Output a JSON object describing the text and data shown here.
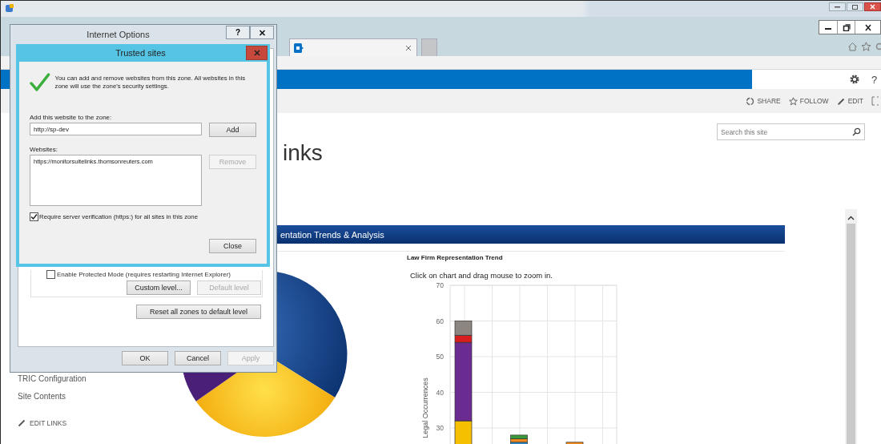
{
  "browser": {
    "tabs": [
      {
        "kind": "page",
        "selected": true
      },
      {
        "kind": "new",
        "selected": false
      }
    ]
  },
  "site": {
    "help": "?",
    "actions": [
      {
        "kind": "share",
        "label": "SHARE"
      },
      {
        "kind": "follow",
        "label": "FOLLOW"
      },
      {
        "kind": "edit",
        "label": "EDIT"
      }
    ],
    "search": {
      "placeholder": "Search this site"
    },
    "page_title": "inks",
    "nav": [
      {
        "label": "TRIC Configuration"
      },
      {
        "label": "Site Contents"
      }
    ],
    "edit_links": "EDIT LINKS",
    "web_part": {
      "title": "entation Trends & Analysis",
      "chart_title": "Law Firm Representation Trend",
      "hint": "Click on chart and drag mouse to zoom in.",
      "chart_data": {
        "type": "bar",
        "stacked": true,
        "grid": true,
        "ylabel": "Legal Occurrences",
        "ylim": [
          0,
          70
        ],
        "yticks": [
          30,
          40,
          50,
          60,
          70
        ],
        "series": [
          {
            "color": "#f5c000",
            "values": [
              32,
              null,
              null
            ]
          },
          {
            "color": "#6a2c91",
            "values": [
              22,
              null,
              null
            ]
          },
          {
            "color": "#d81e1e",
            "values": [
              2,
              null,
              null
            ]
          },
          {
            "color": "#8c8580",
            "values": [
              4,
              null,
              null
            ]
          },
          {
            "color": "#2e8bd0",
            "values": [
              null,
              26,
              null
            ]
          },
          {
            "color": "#f08a1c",
            "values": [
              null,
              1,
              26
            ]
          },
          {
            "color": "#3a9a3a",
            "values": [
              null,
              1,
              null
            ]
          }
        ]
      }
    }
  },
  "internet_options": {
    "title": "Internet Options",
    "help": "?",
    "protected_mode": {
      "label": "Enable Protected Mode (requires restarting Internet Explorer)",
      "checked": false
    },
    "zone_buttons": [
      {
        "label": "Custom level...",
        "disabled": false
      },
      {
        "label": "Default level",
        "disabled": true
      }
    ],
    "reset_button": "Reset all zones to default level",
    "buttons": [
      {
        "label": "OK",
        "disabled": false
      },
      {
        "label": "Cancel",
        "disabled": false
      },
      {
        "label": "Apply",
        "disabled": true
      }
    ]
  },
  "trusted_sites": {
    "title": "Trusted sites",
    "message": "You can add and remove websites from this zone. All websites in this zone will use the zone's security settings.",
    "add_label": "Add this website to the zone:",
    "add_value": "http://sp-dev",
    "add_button": {
      "label": "Add",
      "disabled": false
    },
    "websites_label": "Websites:",
    "websites": [
      {
        "url": "https://monitorsuitelinks.thomsonreuters.com",
        "selected": false
      }
    ],
    "remove_button": {
      "label": "Remove",
      "disabled": true
    },
    "require_https": {
      "label": "Require server verification (https:) for all sites in this zone",
      "checked": true
    },
    "close_button": "Close"
  }
}
